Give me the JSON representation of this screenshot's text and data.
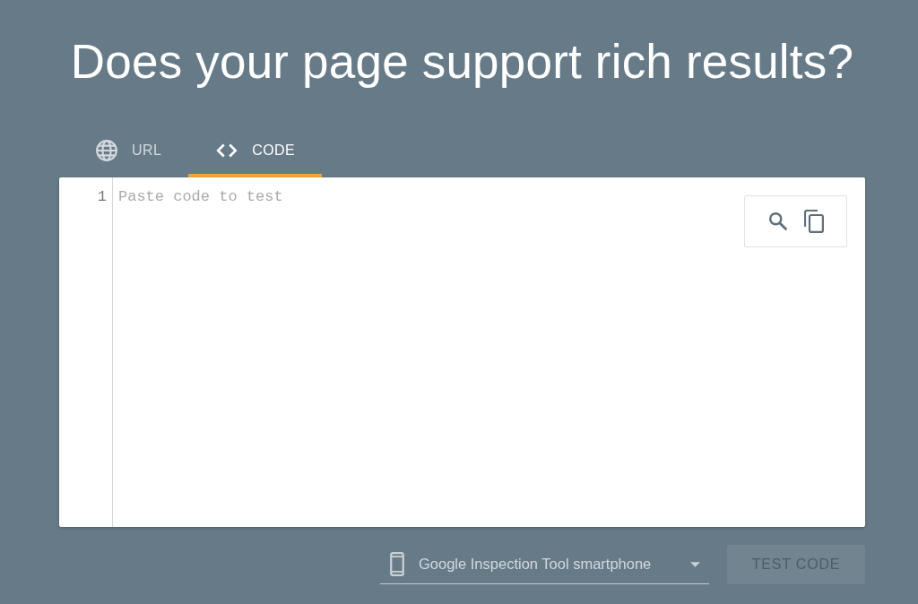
{
  "title": "Does your page support rich results?",
  "tabs": [
    {
      "label": "URL",
      "kind": "globe",
      "selected": false
    },
    {
      "label": "CODE",
      "kind": "code",
      "selected": true
    }
  ],
  "editor": {
    "line_numbers": [
      "1"
    ],
    "placeholder": "Paste code to test"
  },
  "device_select": {
    "value": "Google Inspection Tool smartphone"
  },
  "test_button": {
    "label": "TEST CODE",
    "disabled": true
  }
}
